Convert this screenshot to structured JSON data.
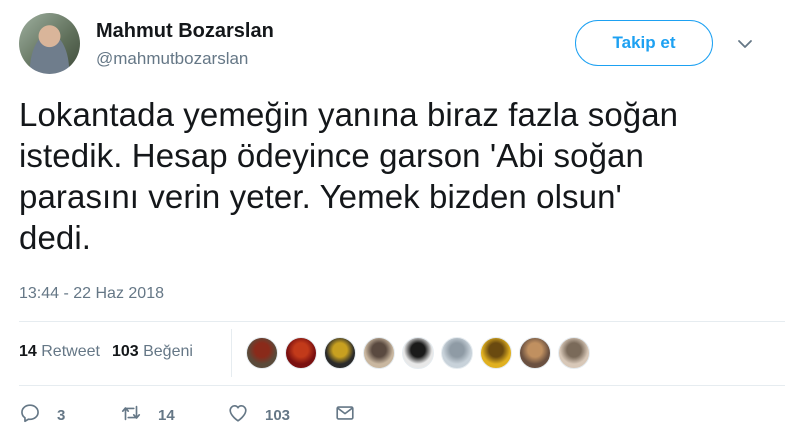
{
  "user": {
    "name": "Mahmut Bozarslan",
    "handle": "@mahmutbozarslan"
  },
  "follow_button": {
    "label": "Takip et"
  },
  "tweet": {
    "text_lines": [
      "Lokantada yemeğin yanına biraz fazla soğan",
      "istedik. Hesap ödeyince garson 'Abi soğan",
      "parasını verin yeter. Yemek bizden olsun'",
      "dedi."
    ],
    "timestamp": "13:44 - 22 Haz 2018"
  },
  "stats": {
    "retweets_count": "14",
    "retweets_label": "Retweet",
    "likes_count": "103",
    "likes_label": "Beğeni"
  },
  "liker_avatars": [
    {
      "colors": [
        "#5a4a3a",
        "#8a2a1a"
      ]
    },
    {
      "colors": [
        "#7a1010",
        "#c23a1a"
      ]
    },
    {
      "colors": [
        "#2a2a2a",
        "#c8a020"
      ]
    },
    {
      "colors": [
        "#c9b7a0",
        "#5a4a40"
      ]
    },
    {
      "colors": [
        "#e8e8e8",
        "#1a1a1a"
      ]
    },
    {
      "colors": [
        "#c8d2da",
        "#8f9ba5"
      ]
    },
    {
      "colors": [
        "#e0b020",
        "#6a4a10"
      ]
    },
    {
      "colors": [
        "#6a5040",
        "#c09060"
      ]
    },
    {
      "colors": [
        "#d8c8b8",
        "#7a6a5a"
      ]
    }
  ],
  "actions": {
    "reply_count": "3",
    "retweet_count": "14",
    "like_count": "103"
  },
  "colors": {
    "accent": "#1da1f2",
    "secondary_text": "#657786",
    "primary_text": "#14171a",
    "divider": "#e6ecf0"
  },
  "icons": [
    "chevron-down-icon",
    "reply-icon",
    "retweet-icon",
    "heart-icon",
    "mail-icon"
  ]
}
